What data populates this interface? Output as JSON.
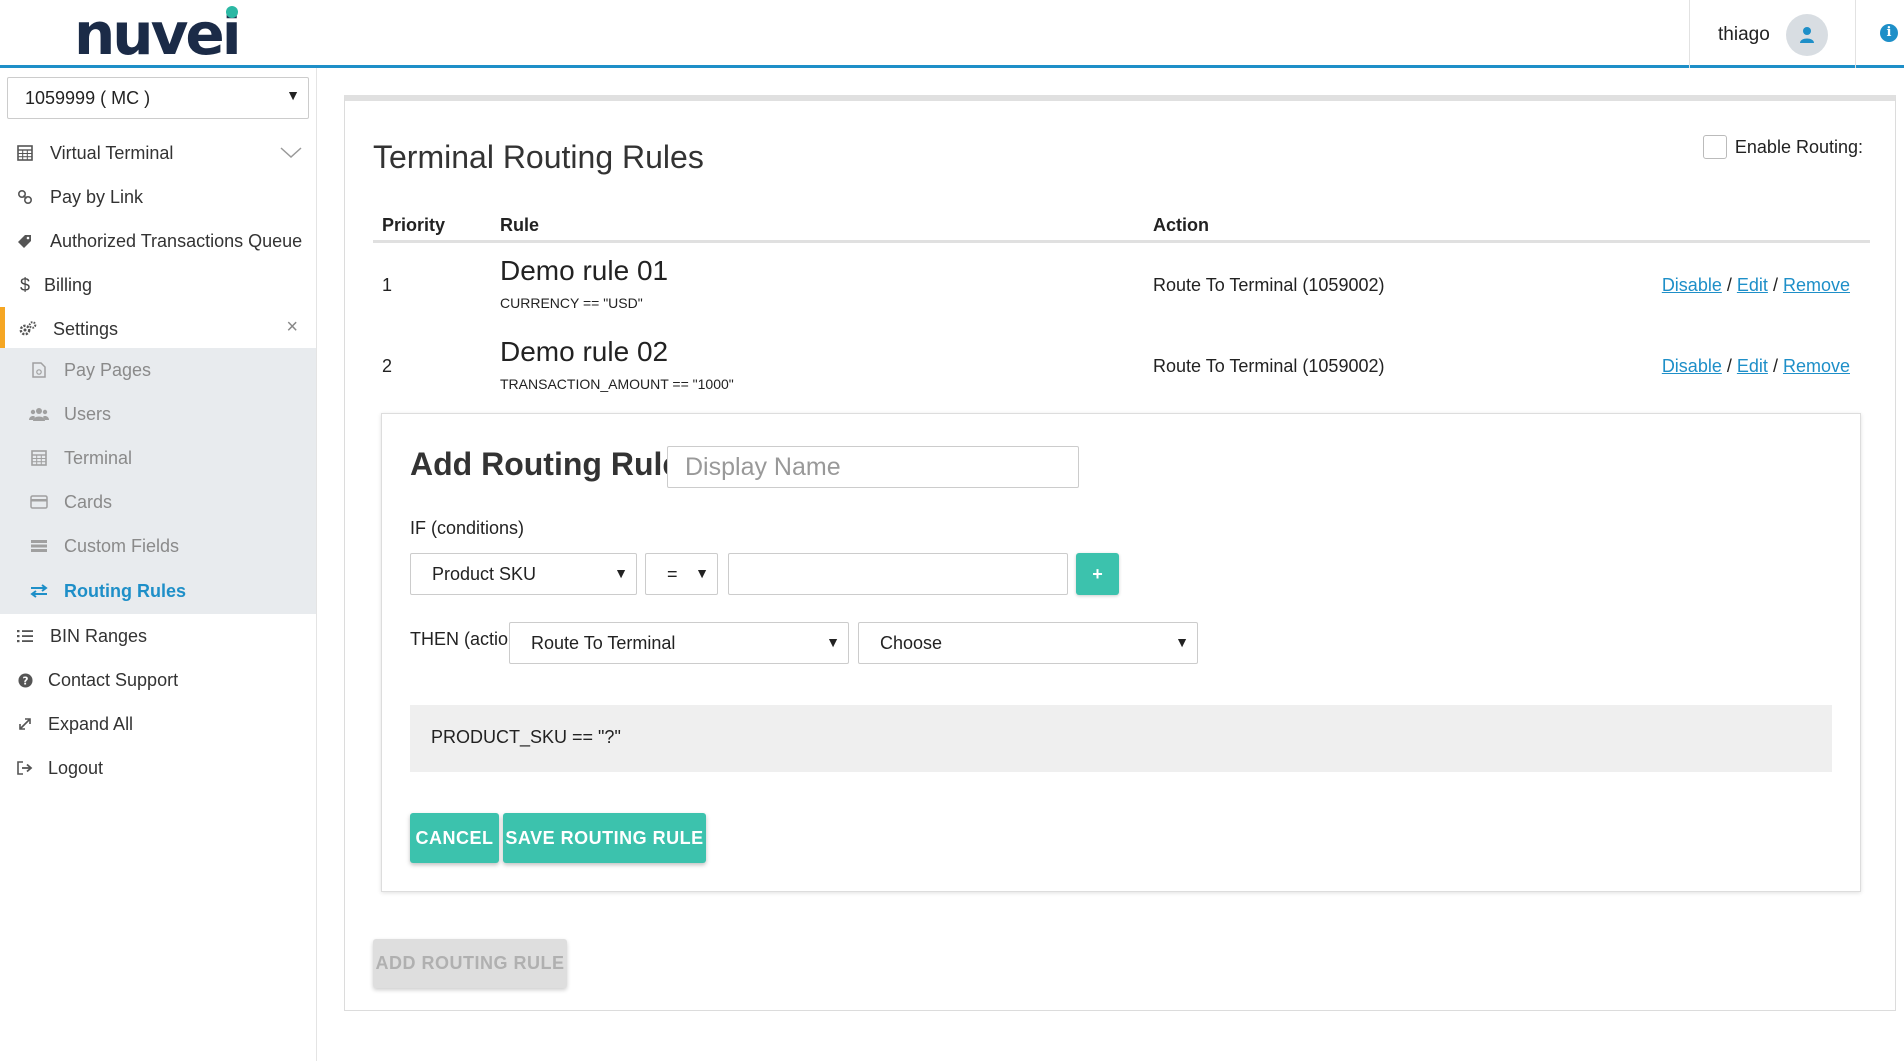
{
  "header": {
    "logo_text": "nuvei",
    "user_name": "thiago"
  },
  "colors": {
    "brand_blue": "#1e8fc8",
    "accent_teal": "#3cc2ad",
    "active_marker": "#f5a623",
    "logo_navy": "#1b2b47"
  },
  "sidebar": {
    "merchant_selected": "1059999 ( MC )",
    "items": [
      {
        "label": "Virtual Terminal",
        "icon": "calculator-icon"
      },
      {
        "label": "Pay by Link",
        "icon": "link-icon"
      },
      {
        "label": "Authorized Transactions Queue",
        "icon": "tag-icon"
      },
      {
        "label": "Billing",
        "icon": "dollar-icon"
      },
      {
        "label": "Settings",
        "icon": "gears-icon"
      },
      {
        "label": "BIN Ranges",
        "icon": "list-icon"
      },
      {
        "label": "Contact Support",
        "icon": "question-circle-icon"
      },
      {
        "label": "Expand All",
        "icon": "expand-icon"
      },
      {
        "label": "Logout",
        "icon": "logout-icon"
      }
    ],
    "settings_sub": [
      {
        "label": "Pay Pages",
        "icon": "file-icon"
      },
      {
        "label": "Users",
        "icon": "users-icon"
      },
      {
        "label": "Terminal",
        "icon": "calculator-icon"
      },
      {
        "label": "Cards",
        "icon": "credit-card-icon"
      },
      {
        "label": "Custom Fields",
        "icon": "fields-icon"
      },
      {
        "label": "Routing Rules",
        "icon": "exchange-icon"
      }
    ],
    "active_sub": "Routing Rules"
  },
  "main": {
    "title": "Terminal Routing Rules",
    "enable_routing_label": "Enable Routing:",
    "enable_routing_checked": false,
    "columns": {
      "priority": "Priority",
      "rule": "Rule",
      "action": "Action"
    },
    "rules": [
      {
        "priority": "1",
        "name": "Demo rule 01",
        "condition": "CURRENCY == \"USD\"",
        "action": "Route To Terminal (1059002)",
        "disable": "Disable",
        "edit": "Edit",
        "remove": "Remove",
        "sep": "/"
      },
      {
        "priority": "2",
        "name": "Demo rule 02",
        "condition": "TRANSACTION_AMOUNT == \"1000\"",
        "action": "Route To Terminal (1059002)",
        "disable": "Disable",
        "edit": "Edit",
        "remove": "Remove",
        "sep": "/"
      }
    ],
    "add_form": {
      "title": "Add Routing Rule",
      "display_name_placeholder": "Display Name",
      "display_name_value": "",
      "if_label": "IF (conditions)",
      "condition_field": "Product SKU",
      "condition_operator": "=",
      "condition_value": "",
      "add_condition_label": "+",
      "then_label": "THEN (action)",
      "action_type": "Route To Terminal",
      "action_target": "Choose",
      "preview": "PRODUCT_SKU == \"?\"",
      "cancel_label": "CANCEL",
      "save_label": "SAVE ROUTING RULE"
    },
    "add_rule_button": "ADD ROUTING RULE"
  }
}
